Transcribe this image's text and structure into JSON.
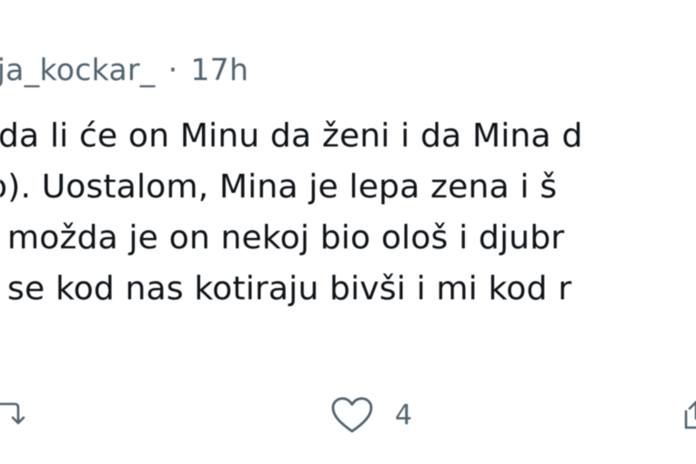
{
  "post": {
    "username": "tija_kockar_",
    "separator": "·",
    "time": "17h",
    "lines": [
      "da li će on Minu da ženi i da Mina d",
      "o). Uostalom, Mina je lepa zena i š",
      "možda je on nekoj bio ološ i djubr",
      "se kod nas kotiraju bivši i mi kod r"
    ]
  },
  "actions": {
    "retweet_icon": "retweet-icon",
    "like_icon": "heart-icon",
    "like_count": "4",
    "share_icon": "share-icon"
  },
  "colors": {
    "text": "#0f1419",
    "secondary": "#536471",
    "background": "#ffffff"
  }
}
